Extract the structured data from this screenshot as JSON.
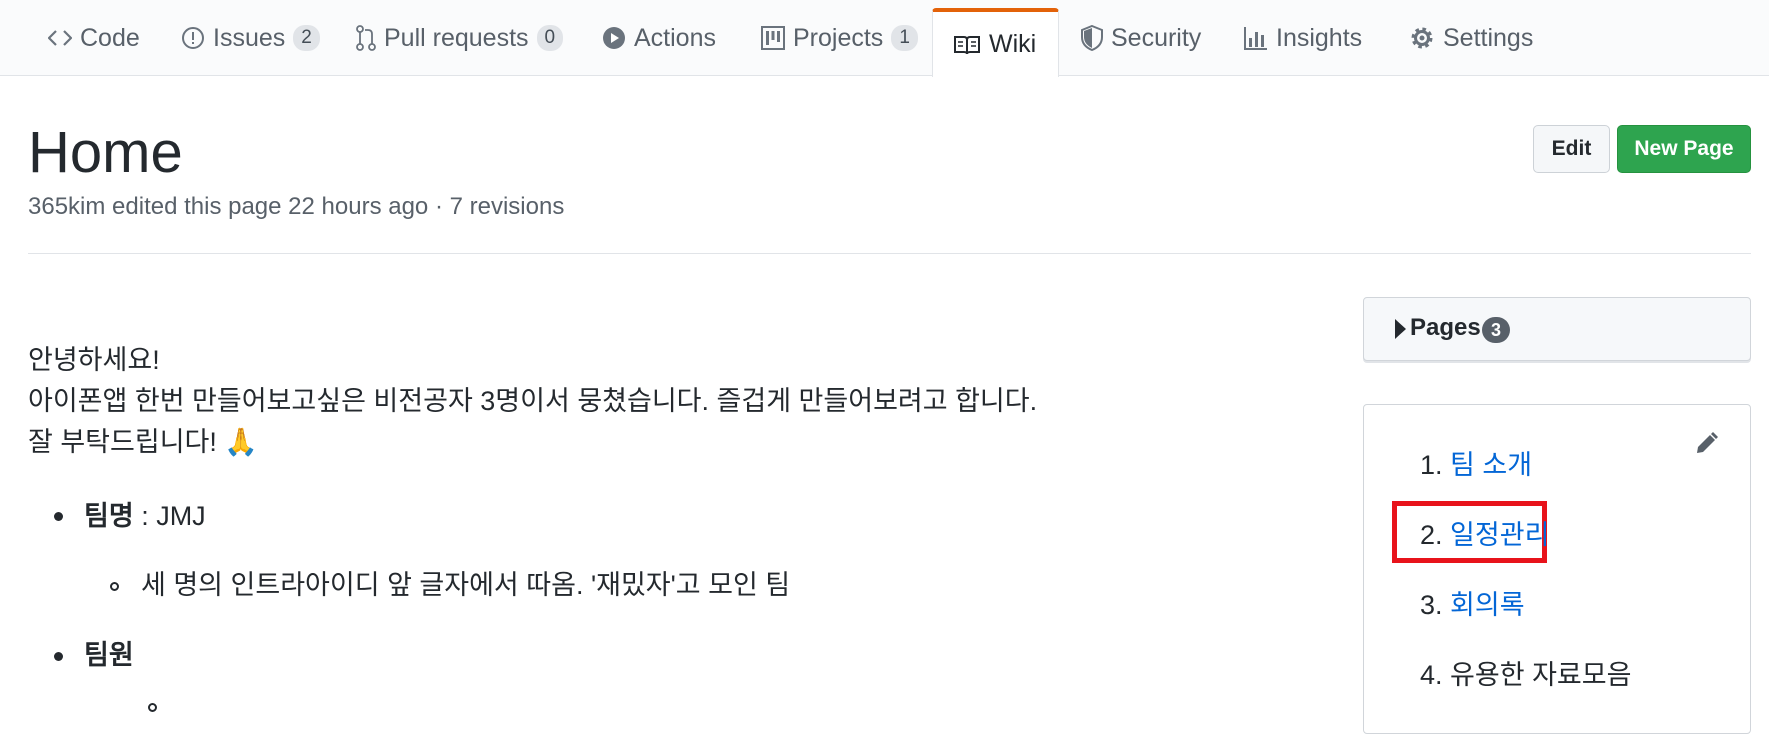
{
  "tabs": [
    {
      "label": "Code",
      "icon": "code-icon"
    },
    {
      "label": "Issues",
      "count": "2",
      "icon": "issue-icon"
    },
    {
      "label": "Pull requests",
      "count": "0",
      "icon": "pull-request-icon"
    },
    {
      "label": "Actions",
      "icon": "play-icon"
    },
    {
      "label": "Projects",
      "count": "1",
      "icon": "project-icon"
    },
    {
      "label": "Wiki",
      "icon": "book-icon",
      "active": true
    },
    {
      "label": "Security",
      "icon": "shield-icon"
    },
    {
      "label": "Insights",
      "icon": "graph-icon"
    },
    {
      "label": "Settings",
      "icon": "gear-icon"
    }
  ],
  "page": {
    "title": "Home",
    "meta": "365kim edited this page 22 hours ago · 7 revisions",
    "edit_label": "Edit",
    "new_page_label": "New Page"
  },
  "content": {
    "line1": "안녕하세요!",
    "line2": "아이폰앱 한번 만들어보고싶은 비전공자 3명이서 뭉쳤습니다. 즐겁게 만들어보려고 합니다.",
    "line3": "잘 부탁드립니다!",
    "line3_emoji": "🙏",
    "team_name_label": "팀명",
    "team_name_value": " : JMJ",
    "team_name_desc": "세 명의 인트라아이디 앞 글자에서 따옴. '재밌자'고 모인 팀",
    "members_label": "팀원"
  },
  "sidebar": {
    "pages_label": "Pages",
    "pages_count": "3",
    "toc": [
      {
        "num": "1.",
        "label": "팀 소개",
        "link": true
      },
      {
        "num": "2.",
        "label": "일정관리",
        "link": true,
        "highlighted": true
      },
      {
        "num": "3.",
        "label": "회의록",
        "link": true
      },
      {
        "num": "4.",
        "label": "유용한 자료모음",
        "link": false
      }
    ]
  },
  "colors": {
    "accent_tab": "#e36209",
    "link": "#0366d6",
    "new_page_button": "#2ea44f",
    "highlight_box": "#e8131b"
  }
}
